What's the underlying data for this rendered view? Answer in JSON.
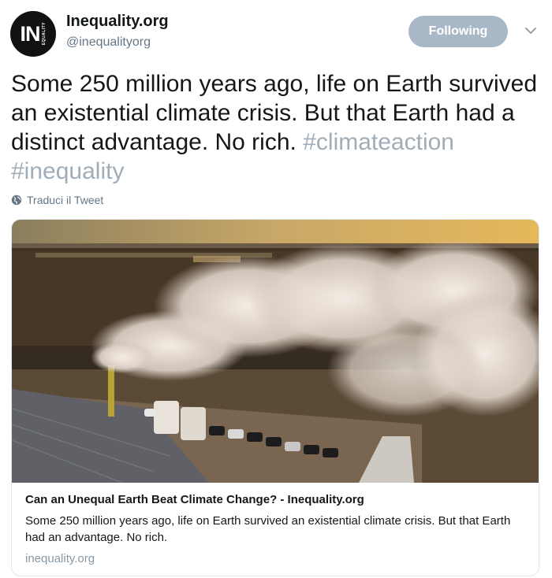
{
  "account": {
    "name": "Inequality.org",
    "handle": "@inequalityorg",
    "avatar_text": "IN",
    "avatar_side_text": "EQUALITY"
  },
  "follow_button": {
    "label": "Following"
  },
  "tweet": {
    "body": "Some 250 million years ago, life on Earth survived an existential climate crisis. But that Earth had a distinct advantage. No rich.",
    "hashtags": "#climateaction #inequality"
  },
  "translate": {
    "label": "Traduci il Tweet"
  },
  "card": {
    "title": "Can an Unequal Earth Beat Climate Change? - Inequality.org",
    "description": "Some 250 million years ago, life on Earth survived an existential climate crisis. But that Earth had an advantage. No rich.",
    "domain": "inequality.org"
  },
  "colors": {
    "follow_button_bg": "#a9b8c6",
    "hashtag": "#a0adb8",
    "secondary_text": "#657786"
  },
  "icons": [
    "chevron-down-icon",
    "globe-icon"
  ]
}
